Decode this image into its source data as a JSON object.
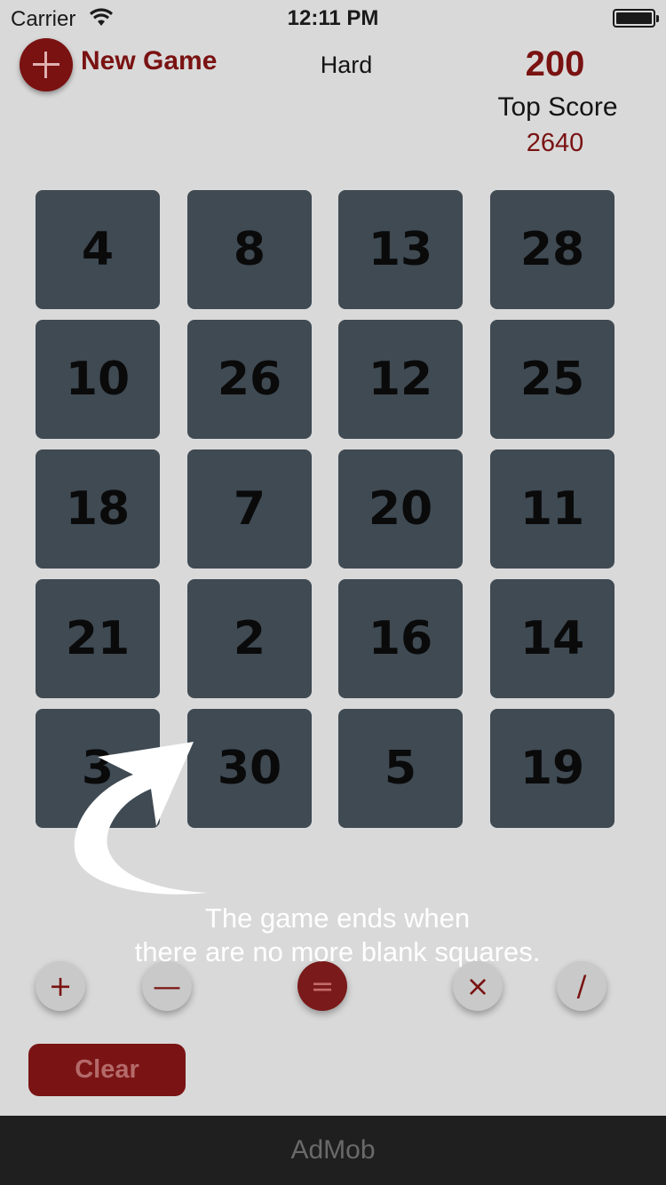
{
  "status_bar": {
    "carrier": "Carrier",
    "time": "12:11 PM"
  },
  "header": {
    "new_game_label": "New Game",
    "difficulty": "Hard",
    "score": "200",
    "top_score_label": "Top Score",
    "top_score_value": "2640"
  },
  "grid": {
    "rows": [
      [
        "4",
        "8",
        "13",
        "28"
      ],
      [
        "10",
        "26",
        "12",
        "25"
      ],
      [
        "18",
        "7",
        "20",
        "11"
      ],
      [
        "21",
        "2",
        "16",
        "14"
      ],
      [
        "3",
        "30",
        "5",
        "19"
      ]
    ]
  },
  "operators": [
    {
      "name": "plus",
      "symbol": "+"
    },
    {
      "name": "minus",
      "symbol": "—"
    },
    {
      "name": "equals",
      "symbol": "="
    },
    {
      "name": "multiply",
      "symbol": "×"
    },
    {
      "name": "divide",
      "symbol": "/"
    }
  ],
  "clear_label": "Clear",
  "tip": {
    "line1": "The game ends when",
    "line2": "there are no more blank squares."
  },
  "ad_label": "AdMob",
  "colors": {
    "accent": "#7a1212",
    "tile": "#3f4a53",
    "overlay_bg": "#d9d9d9"
  }
}
